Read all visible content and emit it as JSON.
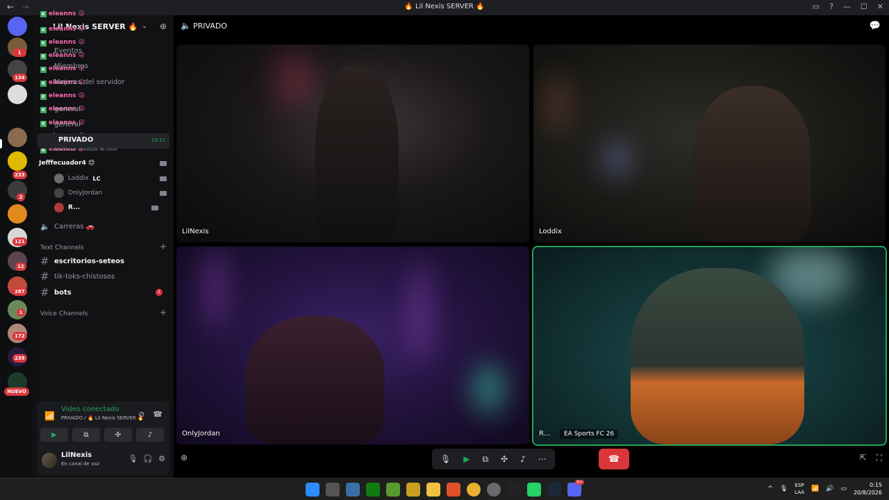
{
  "titlebar": {
    "back": "←",
    "forward": "→",
    "title": "🔥 Lil Nexis SERVER 🔥",
    "controls": [
      "▭",
      "?",
      "—",
      "☐",
      "✕"
    ]
  },
  "rail": {
    "badges": [
      {
        "label": "1"
      },
      {
        "label": "134"
      },
      {
        "label": "233"
      },
      {
        "label": "2"
      },
      {
        "label": "121"
      },
      {
        "label": "12"
      },
      {
        "label": "287"
      },
      {
        "label": "1"
      },
      {
        "label": "172"
      },
      {
        "label": "239"
      }
    ],
    "new_label": "NUEVO"
  },
  "sidebar": {
    "server_name": "Lil Nexis SERVER 🔥",
    "chevron": "⌄",
    "nav_items": [
      {
        "label": "Eventos"
      },
      {
        "label": "Miembros"
      },
      {
        "label": "Mejoras del servidor"
      },
      {
        "label": "general"
      },
      {
        "label": "general"
      }
    ],
    "active_voice": {
      "name": "PRIVADO",
      "timer": "13:11",
      "status_hint": "Establecer un estado de canal"
    },
    "voice_users": [
      {
        "name": "Jefffecuador4 😊",
        "me": true
      },
      {
        "name": "Loddix",
        "tag": "LC",
        "me": false
      },
      {
        "name": "OnlyJordan",
        "me": false
      },
      {
        "name": "R...",
        "me": false
      }
    ],
    "carreras": "Carreras 🚗",
    "text_category": "Text Channels",
    "text_channels": [
      {
        "name": "escritorios-seteos",
        "unread": true
      },
      {
        "name": "tik-toks-chistosos",
        "unread": false
      },
      {
        "name": "bots",
        "unread": true,
        "badge": "1"
      }
    ],
    "voice_category": "Voice Channels",
    "chat_overlay": {
      "name": "eleanns",
      "emoji": "😮",
      "badge": "K"
    }
  },
  "voice_panel": {
    "title": "Video conectado",
    "subtitle": "PRIVADO / 🔥 Lil Nexis SERVER 🔥",
    "buttons": [
      "camera",
      "screen-share",
      "activity",
      "soundboard"
    ]
  },
  "user_panel": {
    "name": "LilNexis",
    "status": "En canal de voz"
  },
  "main": {
    "channel_title": "PRIVADO",
    "tiles": [
      {
        "label": "LilNexis"
      },
      {
        "label": "Loddix"
      },
      {
        "label": "OnlyJordan"
      },
      {
        "label": "R...",
        "activity": "EA Sports FC 26"
      }
    ]
  },
  "call_controls": {
    "mic": "🎙",
    "camera": "▶",
    "screen": "⧉",
    "activity": "✣",
    "soundboard": "♪",
    "more": "⋯",
    "hangup": "☎"
  },
  "taskbar": {
    "lang_top": "ESP",
    "lang_bottom": "LAA",
    "time": "0:15",
    "date": "20/8/2026",
    "discord_badge": "9+"
  },
  "colors": {
    "accent_green": "#23a55a",
    "danger_red": "#da373c",
    "sidebar_bg": "#121214",
    "rail_bg": "#0e0f11"
  }
}
